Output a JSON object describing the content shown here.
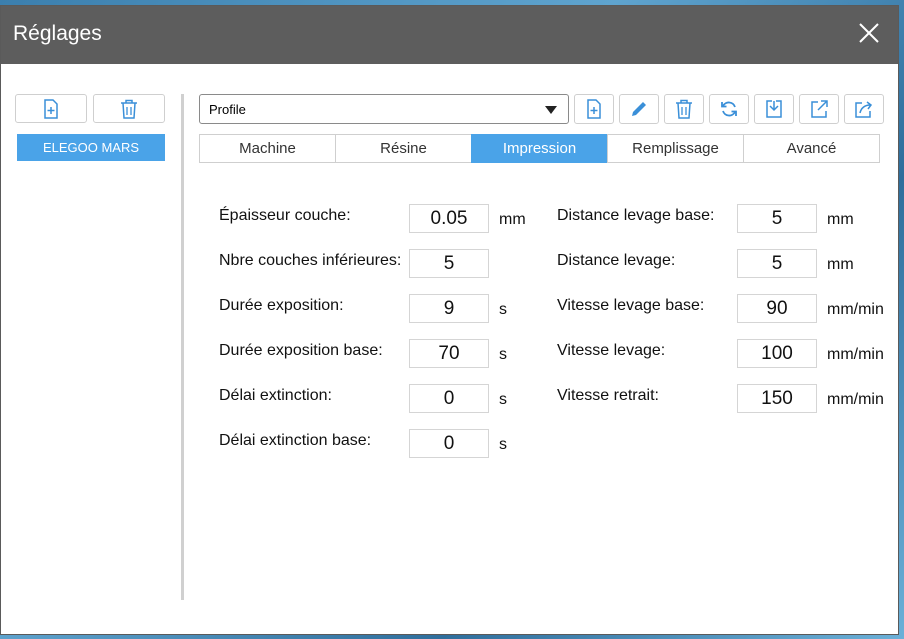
{
  "window": {
    "title": "Réglages"
  },
  "left_panel": {
    "profiles": [
      "ELEGOO MARS"
    ],
    "add_icon": "file-plus-icon",
    "delete_icon": "trash-icon"
  },
  "toolbar": {
    "profile_select_value": "Profile",
    "icons": [
      "file-plus-icon",
      "pencil-icon",
      "trash-icon",
      "refresh-icon",
      "import-icon",
      "export-icon",
      "export-alt-icon"
    ]
  },
  "tabs": [
    {
      "label": "Machine",
      "active": false
    },
    {
      "label": "Résine",
      "active": false
    },
    {
      "label": "Impression",
      "active": true
    },
    {
      "label": "Remplissage",
      "active": false
    },
    {
      "label": "Avancé",
      "active": false
    }
  ],
  "left_fields": [
    {
      "label": "Épaisseur couche:",
      "value": "0.05",
      "unit": "mm"
    },
    {
      "label": "Nbre couches inférieures:",
      "value": "5",
      "unit": ""
    },
    {
      "label": "Durée exposition:",
      "value": "9",
      "unit": "s"
    },
    {
      "label": "Durée exposition base:",
      "value": "70",
      "unit": "s"
    },
    {
      "label": "Délai extinction:",
      "value": "0",
      "unit": "s"
    },
    {
      "label": "Délai extinction base:",
      "value": "0",
      "unit": "s"
    }
  ],
  "right_fields": [
    {
      "label": "Distance levage base:",
      "value": "5",
      "unit": "mm"
    },
    {
      "label": "Distance levage:",
      "value": "5",
      "unit": "mm"
    },
    {
      "label": "Vitesse levage base:",
      "value": "90",
      "unit": "mm/min"
    },
    {
      "label": "Vitesse levage:",
      "value": "100",
      "unit": "mm/min"
    },
    {
      "label": "Vitesse retrait:",
      "value": "150",
      "unit": "mm/min"
    }
  ],
  "colors": {
    "accent": "#4aa3e8",
    "titlebar": "#5d5d5d",
    "icon_blue": "#3a8fd8"
  }
}
